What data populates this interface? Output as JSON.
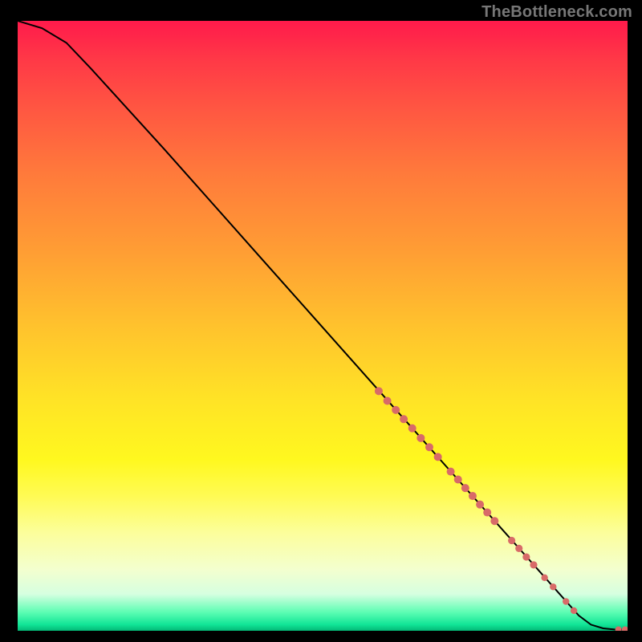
{
  "attribution": "TheBottleneck.com",
  "colors": {
    "dot": "#d86a68",
    "curve": "#000000"
  },
  "chart_data": {
    "type": "line",
    "title": "",
    "xlabel": "",
    "ylabel": "",
    "xlim": [
      0,
      100
    ],
    "ylim": [
      0,
      100
    ],
    "grid": false,
    "legend": false,
    "curve": [
      {
        "x": 0,
        "y": 100
      },
      {
        "x": 4,
        "y": 98.8
      },
      {
        "x": 8,
        "y": 96.4
      },
      {
        "x": 12,
        "y": 92.2
      },
      {
        "x": 16,
        "y": 87.8
      },
      {
        "x": 24,
        "y": 79.0
      },
      {
        "x": 32,
        "y": 70.0
      },
      {
        "x": 40,
        "y": 61.0
      },
      {
        "x": 48,
        "y": 52.0
      },
      {
        "x": 56,
        "y": 43.0
      },
      {
        "x": 64,
        "y": 34.0
      },
      {
        "x": 72,
        "y": 25.0
      },
      {
        "x": 80,
        "y": 16.0
      },
      {
        "x": 88,
        "y": 7.0
      },
      {
        "x": 92,
        "y": 2.5
      },
      {
        "x": 94,
        "y": 1.0
      },
      {
        "x": 96,
        "y": 0.4
      },
      {
        "x": 98,
        "y": 0.2
      },
      {
        "x": 100,
        "y": 0.2
      }
    ],
    "clusters": [
      {
        "x": 59.2,
        "y": 39.3,
        "r": 5
      },
      {
        "x": 60.6,
        "y": 37.7,
        "r": 5
      },
      {
        "x": 62.0,
        "y": 36.2,
        "r": 5
      },
      {
        "x": 63.3,
        "y": 34.7,
        "r": 5
      },
      {
        "x": 64.7,
        "y": 33.2,
        "r": 5
      },
      {
        "x": 66.1,
        "y": 31.6,
        "r": 5
      },
      {
        "x": 67.5,
        "y": 30.1,
        "r": 5
      },
      {
        "x": 68.9,
        "y": 28.5,
        "r": 5
      },
      {
        "x": 71.0,
        "y": 26.1,
        "r": 5
      },
      {
        "x": 72.2,
        "y": 24.8,
        "r": 5
      },
      {
        "x": 73.4,
        "y": 23.4,
        "r": 5
      },
      {
        "x": 74.6,
        "y": 22.1,
        "r": 5
      },
      {
        "x": 75.8,
        "y": 20.7,
        "r": 5
      },
      {
        "x": 77.0,
        "y": 19.4,
        "r": 5
      },
      {
        "x": 78.2,
        "y": 18.0,
        "r": 5
      },
      {
        "x": 81.0,
        "y": 14.8,
        "r": 4.6
      },
      {
        "x": 82.2,
        "y": 13.5,
        "r": 4.6
      },
      {
        "x": 83.4,
        "y": 12.1,
        "r": 4.6
      },
      {
        "x": 84.6,
        "y": 10.8,
        "r": 4.6
      },
      {
        "x": 86.4,
        "y": 8.7,
        "r": 4.2
      },
      {
        "x": 87.8,
        "y": 7.2,
        "r": 4.2
      },
      {
        "x": 89.9,
        "y": 4.8,
        "r": 4.2
      },
      {
        "x": 91.2,
        "y": 3.3,
        "r": 4.2
      },
      {
        "x": 98.5,
        "y": 0.2,
        "r": 4.0
      },
      {
        "x": 99.6,
        "y": 0.2,
        "r": 4.0
      }
    ]
  }
}
